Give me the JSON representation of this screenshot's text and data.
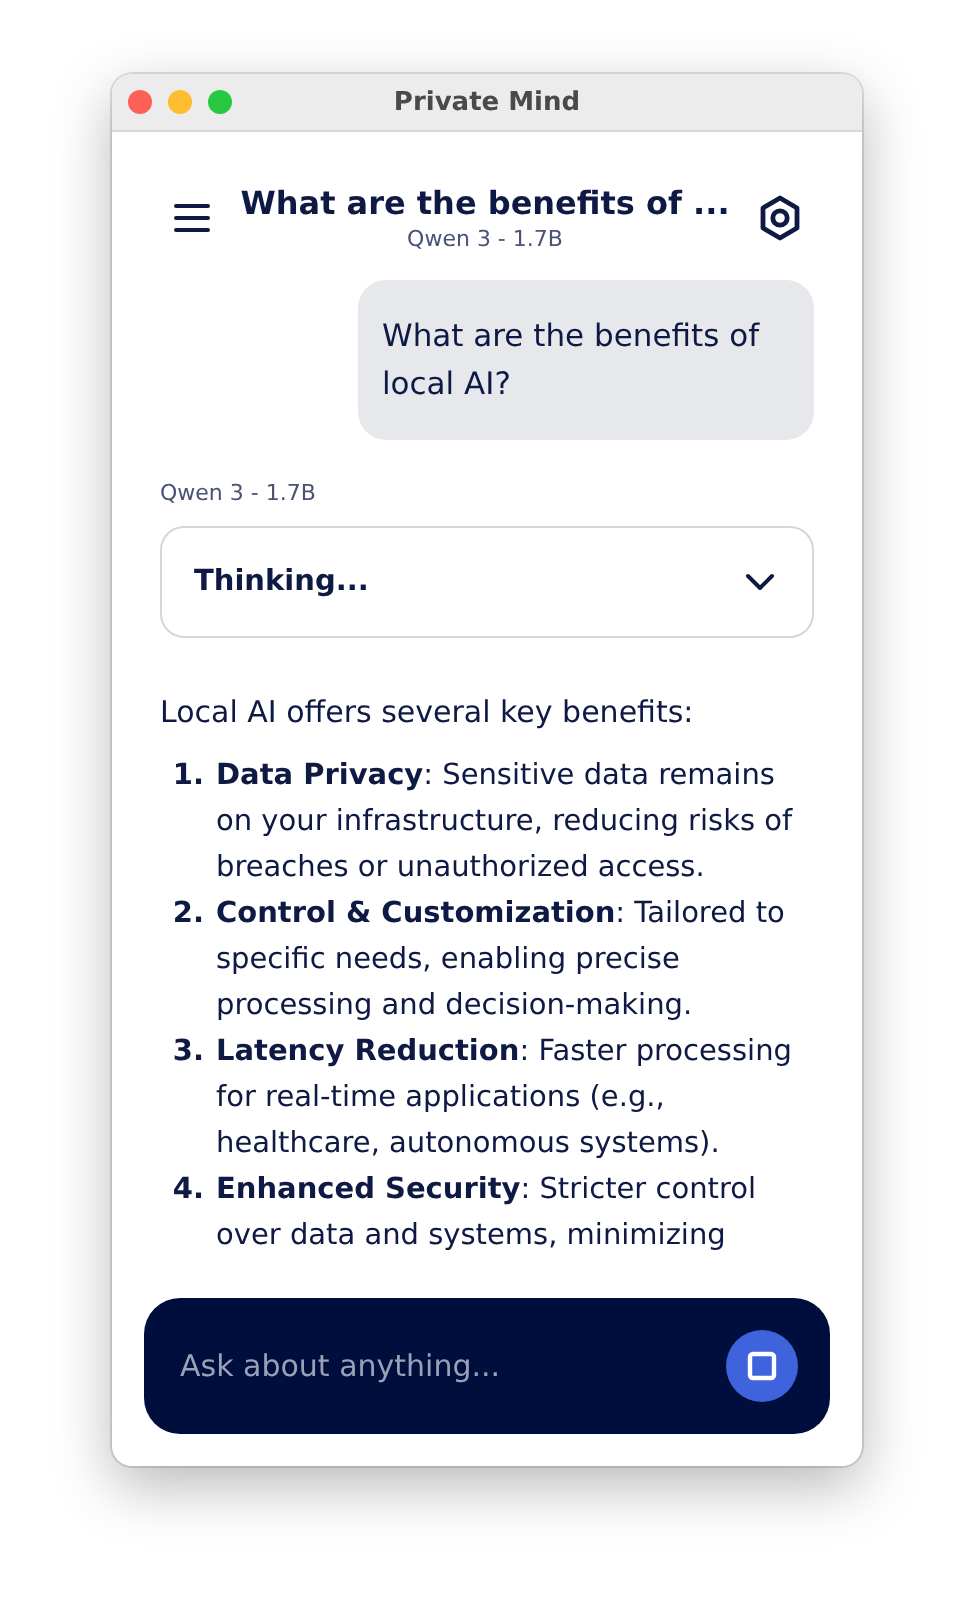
{
  "window": {
    "title": "Private Mind"
  },
  "header": {
    "title": "What are the benefits of ...",
    "subtitle": "Qwen 3 - 1.7B"
  },
  "messages": [
    {
      "kind": "user",
      "text": "What are the benefits of local AI?"
    },
    {
      "kind": "assistant",
      "model": "Qwen 3 - 1.7B",
      "thinking": {
        "label": "Thinking...",
        "expanded": false
      },
      "intro": "Local AI offers several key benefits:",
      "items": [
        {
          "number": "1.",
          "text": "**Data Privacy**: Sensitive data remains on your infrastructure, reducing risks of breaches or unauthorized access."
        },
        {
          "number": "2.",
          "text": "**Control & Customization**: Tailored to specific needs, enabling precise processing and decision-making."
        },
        {
          "number": "3.",
          "text": "**Latency Reduction**: Faster processing for real-time applications (e.g., healthcare, autonomous systems)."
        },
        {
          "number": "4.",
          "text": "**Enhanced Security**: Stricter control over data and systems, minimizing"
        }
      ]
    }
  ],
  "composer": {
    "placeholder": "Ask about anything..."
  }
}
